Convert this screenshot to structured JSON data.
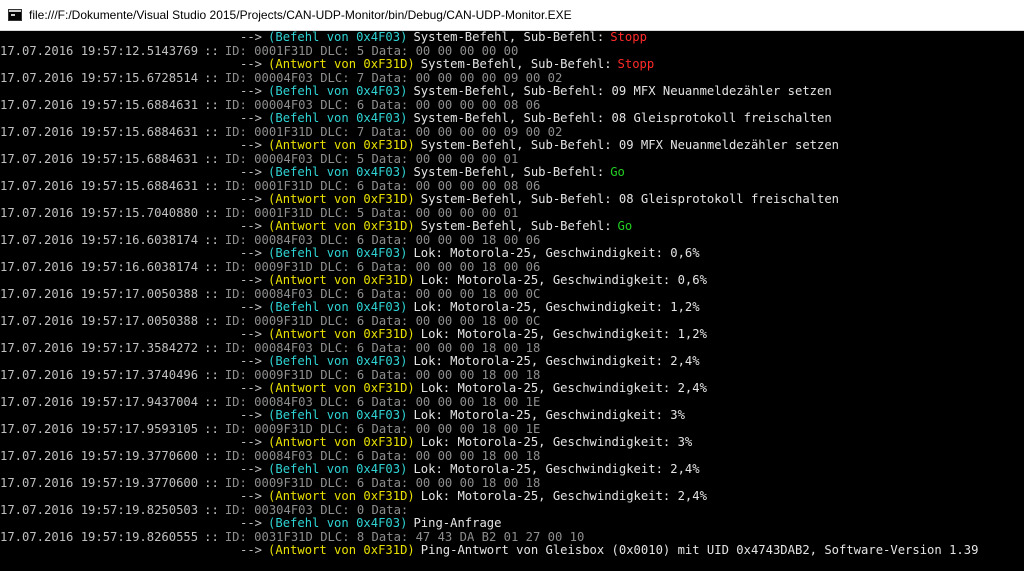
{
  "window": {
    "title": "file:///F:/Dokumente/Visual Studio 2015/Projects/CAN-UDP-Monitor/bin/Debug/CAN-UDP-Monitor.EXE"
  },
  "colors": {
    "background": "#000000",
    "text": "#c0c0c0",
    "raw": "#8e8e8e",
    "befehl": "#2fd3d3",
    "antwort": "#e8e000",
    "stopp": "#ff2a2a",
    "go": "#22d022"
  },
  "separator": "::",
  "arrow": "-->",
  "log": [
    {
      "type": "decoded",
      "arrow": "-->",
      "cmd": "(Befehl von 0x4F03)",
      "cmd_color": "cyan",
      "desc": "System-Befehl, Sub-Befehl:",
      "hl": "Stopp",
      "hl_color": "red"
    },
    {
      "type": "raw",
      "ts": "17.07.2016 19:57:12.5143769",
      "sep": "::",
      "raw": "ID: 0001F31D DLC: 5 Data: 00 00 00 00 00"
    },
    {
      "type": "decoded",
      "arrow": "-->",
      "cmd": "(Antwort von 0xF31D)",
      "cmd_color": "yellow",
      "desc": "System-Befehl, Sub-Befehl:",
      "hl": "Stopp",
      "hl_color": "red"
    },
    {
      "type": "raw",
      "ts": "17.07.2016 19:57:15.6728514",
      "sep": "::",
      "raw": "ID: 00004F03 DLC: 7 Data: 00 00 00 00 09 00 02"
    },
    {
      "type": "decoded",
      "arrow": "-->",
      "cmd": "(Befehl von 0x4F03)",
      "cmd_color": "cyan",
      "desc": "System-Befehl, Sub-Befehl: 09 MFX Neuanmeldezähler setzen",
      "hl": "",
      "hl_color": ""
    },
    {
      "type": "raw",
      "ts": "17.07.2016 19:57:15.6884631",
      "sep": "::",
      "raw": "ID: 00004F03 DLC: 6 Data: 00 00 00 00 08 06"
    },
    {
      "type": "decoded",
      "arrow": "-->",
      "cmd": "(Befehl von 0x4F03)",
      "cmd_color": "cyan",
      "desc": "System-Befehl, Sub-Befehl: 08 Gleisprotokoll freischalten",
      "hl": "",
      "hl_color": ""
    },
    {
      "type": "raw",
      "ts": "17.07.2016 19:57:15.6884631",
      "sep": "::",
      "raw": "ID: 0001F31D DLC: 7 Data: 00 00 00 00 09 00 02"
    },
    {
      "type": "decoded",
      "arrow": "-->",
      "cmd": "(Antwort von 0xF31D)",
      "cmd_color": "yellow",
      "desc": "System-Befehl, Sub-Befehl: 09 MFX Neuanmeldezähler setzen",
      "hl": "",
      "hl_color": ""
    },
    {
      "type": "raw",
      "ts": "17.07.2016 19:57:15.6884631",
      "sep": "::",
      "raw": "ID: 00004F03 DLC: 5 Data: 00 00 00 00 01"
    },
    {
      "type": "decoded",
      "arrow": "-->",
      "cmd": "(Befehl von 0x4F03)",
      "cmd_color": "cyan",
      "desc": "System-Befehl, Sub-Befehl:",
      "hl": "Go",
      "hl_color": "green"
    },
    {
      "type": "raw",
      "ts": "17.07.2016 19:57:15.6884631",
      "sep": "::",
      "raw": "ID: 0001F31D DLC: 6 Data: 00 00 00 00 08 06"
    },
    {
      "type": "decoded",
      "arrow": "-->",
      "cmd": "(Antwort von 0xF31D)",
      "cmd_color": "yellow",
      "desc": "System-Befehl, Sub-Befehl: 08 Gleisprotokoll freischalten",
      "hl": "",
      "hl_color": ""
    },
    {
      "type": "raw",
      "ts": "17.07.2016 19:57:15.7040880",
      "sep": "::",
      "raw": "ID: 0001F31D DLC: 5 Data: 00 00 00 00 01"
    },
    {
      "type": "decoded",
      "arrow": "-->",
      "cmd": "(Antwort von 0xF31D)",
      "cmd_color": "yellow",
      "desc": "System-Befehl, Sub-Befehl:",
      "hl": "Go",
      "hl_color": "green"
    },
    {
      "type": "raw",
      "ts": "17.07.2016 19:57:16.6038174",
      "sep": "::",
      "raw": "ID: 00084F03 DLC: 6 Data: 00 00 00 18 00 06"
    },
    {
      "type": "decoded",
      "arrow": "-->",
      "cmd": "(Befehl von 0x4F03)",
      "cmd_color": "cyan",
      "desc": "Lok: Motorola-25, Geschwindigkeit: 0,6%",
      "hl": "",
      "hl_color": ""
    },
    {
      "type": "raw",
      "ts": "17.07.2016 19:57:16.6038174",
      "sep": "::",
      "raw": "ID: 0009F31D DLC: 6 Data: 00 00 00 18 00 06"
    },
    {
      "type": "decoded",
      "arrow": "-->",
      "cmd": "(Antwort von 0xF31D)",
      "cmd_color": "yellow",
      "desc": "Lok: Motorola-25, Geschwindigkeit: 0,6%",
      "hl": "",
      "hl_color": ""
    },
    {
      "type": "raw",
      "ts": "17.07.2016 19:57:17.0050388",
      "sep": "::",
      "raw": "ID: 00084F03 DLC: 6 Data: 00 00 00 18 00 0C"
    },
    {
      "type": "decoded",
      "arrow": "-->",
      "cmd": "(Befehl von 0x4F03)",
      "cmd_color": "cyan",
      "desc": "Lok: Motorola-25, Geschwindigkeit: 1,2%",
      "hl": "",
      "hl_color": ""
    },
    {
      "type": "raw",
      "ts": "17.07.2016 19:57:17.0050388",
      "sep": "::",
      "raw": "ID: 0009F31D DLC: 6 Data: 00 00 00 18 00 0C"
    },
    {
      "type": "decoded",
      "arrow": "-->",
      "cmd": "(Antwort von 0xF31D)",
      "cmd_color": "yellow",
      "desc": "Lok: Motorola-25, Geschwindigkeit: 1,2%",
      "hl": "",
      "hl_color": ""
    },
    {
      "type": "raw",
      "ts": "17.07.2016 19:57:17.3584272",
      "sep": "::",
      "raw": "ID: 00084F03 DLC: 6 Data: 00 00 00 18 00 18"
    },
    {
      "type": "decoded",
      "arrow": "-->",
      "cmd": "(Befehl von 0x4F03)",
      "cmd_color": "cyan",
      "desc": "Lok: Motorola-25, Geschwindigkeit: 2,4%",
      "hl": "",
      "hl_color": ""
    },
    {
      "type": "raw",
      "ts": "17.07.2016 19:57:17.3740496",
      "sep": "::",
      "raw": "ID: 0009F31D DLC: 6 Data: 00 00 00 18 00 18"
    },
    {
      "type": "decoded",
      "arrow": "-->",
      "cmd": "(Antwort von 0xF31D)",
      "cmd_color": "yellow",
      "desc": "Lok: Motorola-25, Geschwindigkeit: 2,4%",
      "hl": "",
      "hl_color": ""
    },
    {
      "type": "raw",
      "ts": "17.07.2016 19:57:17.9437004",
      "sep": "::",
      "raw": "ID: 00084F03 DLC: 6 Data: 00 00 00 18 00 1E"
    },
    {
      "type": "decoded",
      "arrow": "-->",
      "cmd": "(Befehl von 0x4F03)",
      "cmd_color": "cyan",
      "desc": "Lok: Motorola-25, Geschwindigkeit: 3%",
      "hl": "",
      "hl_color": ""
    },
    {
      "type": "raw",
      "ts": "17.07.2016 19:57:17.9593105",
      "sep": "::",
      "raw": "ID: 0009F31D DLC: 6 Data: 00 00 00 18 00 1E"
    },
    {
      "type": "decoded",
      "arrow": "-->",
      "cmd": "(Antwort von 0xF31D)",
      "cmd_color": "yellow",
      "desc": "Lok: Motorola-25, Geschwindigkeit: 3%",
      "hl": "",
      "hl_color": ""
    },
    {
      "type": "raw",
      "ts": "17.07.2016 19:57:19.3770600",
      "sep": "::",
      "raw": "ID: 00084F03 DLC: 6 Data: 00 00 00 18 00 18"
    },
    {
      "type": "decoded",
      "arrow": "-->",
      "cmd": "(Befehl von 0x4F03)",
      "cmd_color": "cyan",
      "desc": "Lok: Motorola-25, Geschwindigkeit: 2,4%",
      "hl": "",
      "hl_color": ""
    },
    {
      "type": "raw",
      "ts": "17.07.2016 19:57:19.3770600",
      "sep": "::",
      "raw": "ID: 0009F31D DLC: 6 Data: 00 00 00 18 00 18"
    },
    {
      "type": "decoded",
      "arrow": "-->",
      "cmd": "(Antwort von 0xF31D)",
      "cmd_color": "yellow",
      "desc": "Lok: Motorola-25, Geschwindigkeit: 2,4%",
      "hl": "",
      "hl_color": ""
    },
    {
      "type": "raw",
      "ts": "17.07.2016 19:57:19.8250503",
      "sep": "::",
      "raw": "ID: 00304F03 DLC: 0 Data:"
    },
    {
      "type": "decoded",
      "arrow": "-->",
      "cmd": "(Befehl von 0x4F03)",
      "cmd_color": "cyan",
      "desc": "Ping-Anfrage",
      "hl": "",
      "hl_color": ""
    },
    {
      "type": "raw",
      "ts": "17.07.2016 19:57:19.8260555",
      "sep": "::",
      "raw": "ID: 0031F31D DLC: 8 Data: 47 43 DA B2 01 27 00 10"
    },
    {
      "type": "decoded",
      "arrow": "-->",
      "cmd": "(Antwort von 0xF31D)",
      "cmd_color": "yellow",
      "desc": "Ping-Antwort von Gleisbox (0x0010) mit UID 0x4743DAB2, Software-Version 1.39",
      "hl": "",
      "hl_color": ""
    }
  ]
}
